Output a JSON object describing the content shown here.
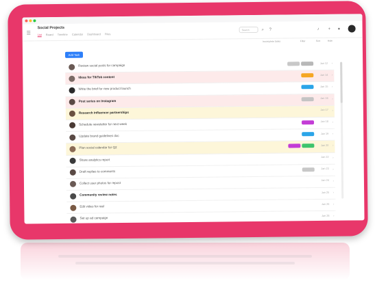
{
  "app": {
    "project_title": "Social Projects",
    "tabs": [
      "List",
      "Board",
      "Timeline",
      "Calendar",
      "Dashboard",
      "Files"
    ],
    "search_placeholder": "Search"
  },
  "toolbar": {
    "add_label": "Add Task",
    "actions": [
      "Incomplete tasks",
      "Filter",
      "Sort",
      "Hide"
    ]
  },
  "tasks": [
    {
      "text": "Review social posts for campaign",
      "tags": [
        {
          "label": "",
          "color": "#c8c8c8"
        },
        {
          "label": "",
          "color": "#b8b8b8"
        }
      ],
      "date": "Jan 12",
      "highlight": "none",
      "bold": false,
      "avatar": "#6a5a55"
    },
    {
      "text": "Ideas for TikTok content",
      "tags": [
        {
          "label": "",
          "color": "#f5a623"
        }
      ],
      "date": "Jan 14",
      "highlight": "pink",
      "bold": true,
      "avatar": "#7a6a65"
    },
    {
      "text": "Write the brief for new product launch",
      "tags": [
        {
          "label": "",
          "color": "#2ba5e8"
        }
      ],
      "date": "Jan 15",
      "highlight": "none",
      "bold": false,
      "avatar": "#2a2a2a"
    },
    {
      "text": "Post series on Instagram",
      "tags": [
        {
          "label": "",
          "color": "#c4c4c4"
        }
      ],
      "date": "Jan 16",
      "highlight": "pink",
      "bold": true,
      "avatar": "#5a4a45"
    },
    {
      "text": "Research influencer partnerships",
      "tags": [],
      "date": "Jan 17",
      "highlight": "yellow",
      "bold": true,
      "avatar": "#6a5040"
    },
    {
      "text": "Schedule newsletter for next week",
      "tags": [
        {
          "label": "",
          "color": "#c33dd6"
        }
      ],
      "date": "Jan 18",
      "highlight": "none",
      "bold": false,
      "avatar": "#4a3a35"
    },
    {
      "text": "Update brand guidelines doc",
      "tags": [
        {
          "label": "",
          "color": "#2ba5e8"
        }
      ],
      "date": "Jan 19",
      "highlight": "none",
      "bold": false,
      "avatar": "#5a4a45"
    },
    {
      "text": "Plan social calendar for Q2",
      "tags": [
        {
          "label": "",
          "color": "#c33dd6"
        },
        {
          "label": "",
          "color": "#3ec46d"
        }
      ],
      "date": "Jan 20",
      "highlight": "yellow",
      "bold": false,
      "avatar": "#8a6a55"
    },
    {
      "text": "Share analytics report",
      "tags": [],
      "date": "Jan 22",
      "highlight": "none",
      "bold": false,
      "avatar": "#3a3a3a"
    },
    {
      "text": "Draft replies to comments",
      "tags": [
        {
          "label": "",
          "color": "#c8c8c8"
        }
      ],
      "date": "Jan 23",
      "highlight": "none",
      "bold": false,
      "avatar": "#5a4a45"
    },
    {
      "text": "Collect user photos for repost",
      "tags": [],
      "date": "Jan 24",
      "highlight": "none",
      "bold": false,
      "avatar": "#6a5a55"
    },
    {
      "text": "Community review notes",
      "tags": [],
      "date": "Jan 25",
      "highlight": "none",
      "bold": true,
      "avatar": "#4a4a4a"
    },
    {
      "text": "Edit video for reel",
      "tags": [],
      "date": "Jan 26",
      "highlight": "none",
      "bold": false,
      "avatar": "#7a5a45"
    },
    {
      "text": "Set up ad campaign",
      "tags": [],
      "date": "Jan 28",
      "highlight": "none",
      "bold": false,
      "avatar": "#5a5a5a"
    }
  ],
  "colors": {
    "frame": "#e8376a",
    "accent": "#2d7ff9",
    "active_tab": "#e8376a"
  },
  "icons": [
    "hamburger-icon",
    "search-icon",
    "bell-icon",
    "help-icon",
    "plus-icon",
    "user-avatar",
    "chevron-icon"
  ]
}
